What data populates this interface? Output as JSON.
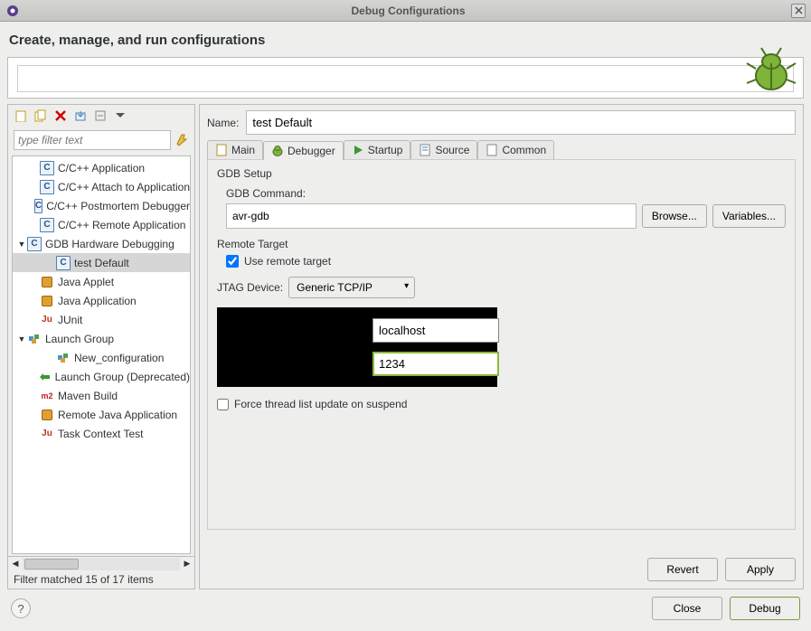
{
  "window": {
    "title": "Debug Configurations"
  },
  "header": {
    "title": "Create, manage, and run configurations"
  },
  "filter": {
    "placeholder": "type filter text",
    "status": "Filter matched 15 of 17 items"
  },
  "tree": {
    "items": [
      {
        "label": "C/C++ Application"
      },
      {
        "label": "C/C++ Attach to Application"
      },
      {
        "label": "C/C++ Postmortem Debugger"
      },
      {
        "label": "C/C++ Remote Application"
      },
      {
        "label": "GDB Hardware Debugging"
      },
      {
        "label": "test Default"
      },
      {
        "label": "Java Applet"
      },
      {
        "label": "Java Application"
      },
      {
        "label": "JUnit"
      },
      {
        "label": "Launch Group"
      },
      {
        "label": "New_configuration"
      },
      {
        "label": "Launch Group (Deprecated)"
      },
      {
        "label": "Maven Build"
      },
      {
        "label": "Remote Java Application"
      },
      {
        "label": "Task Context Test"
      }
    ]
  },
  "form": {
    "name_label": "Name:",
    "name_value": "test Default",
    "tabs": {
      "main": "Main",
      "debugger": "Debugger",
      "startup": "Startup",
      "source": "Source",
      "common": "Common"
    },
    "group_title": "GDB Setup",
    "gdb_command_label": "GDB Command:",
    "gdb_command_value": "avr-gdb",
    "browse": "Browse...",
    "variables": "Variables...",
    "remote_title": "Remote Target",
    "use_remote": "Use remote target",
    "jtag_label": "JTAG Device:",
    "jtag_value": "Generic TCP/IP",
    "host_value": "localhost",
    "port_value": "1234",
    "force_thread": "Force thread list update on suspend",
    "revert": "Revert",
    "apply": "Apply"
  },
  "footer": {
    "close": "Close",
    "debug": "Debug"
  }
}
